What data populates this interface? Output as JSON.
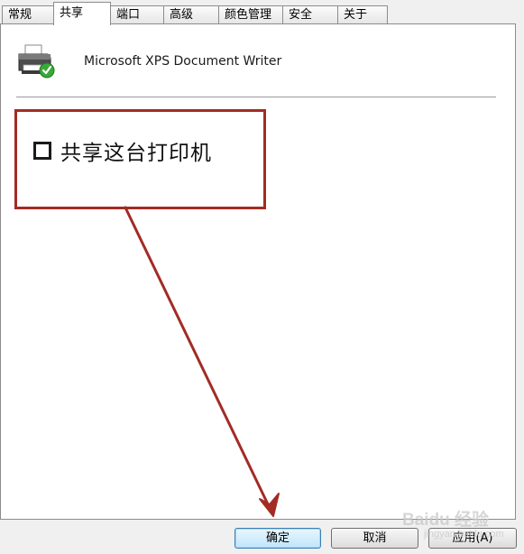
{
  "tabs": [
    {
      "label": "常规"
    },
    {
      "label": "共享"
    },
    {
      "label": "端口"
    },
    {
      "label": "高级"
    },
    {
      "label": "颜色管理"
    },
    {
      "label": "安全"
    },
    {
      "label": "关于"
    }
  ],
  "printer": {
    "name": "Microsoft XPS Document Writer",
    "icon": "printer-icon"
  },
  "share": {
    "label": "共享这台打印机",
    "checked": false
  },
  "buttons": {
    "ok": "确定",
    "cancel": "取消",
    "apply": "应用(A)"
  },
  "watermark": {
    "text": "Baidu 经验",
    "sub": "jingyan.baidu.com"
  },
  "colors": {
    "annotation": "#a32b25",
    "primary_border": "#3c7fb1"
  }
}
